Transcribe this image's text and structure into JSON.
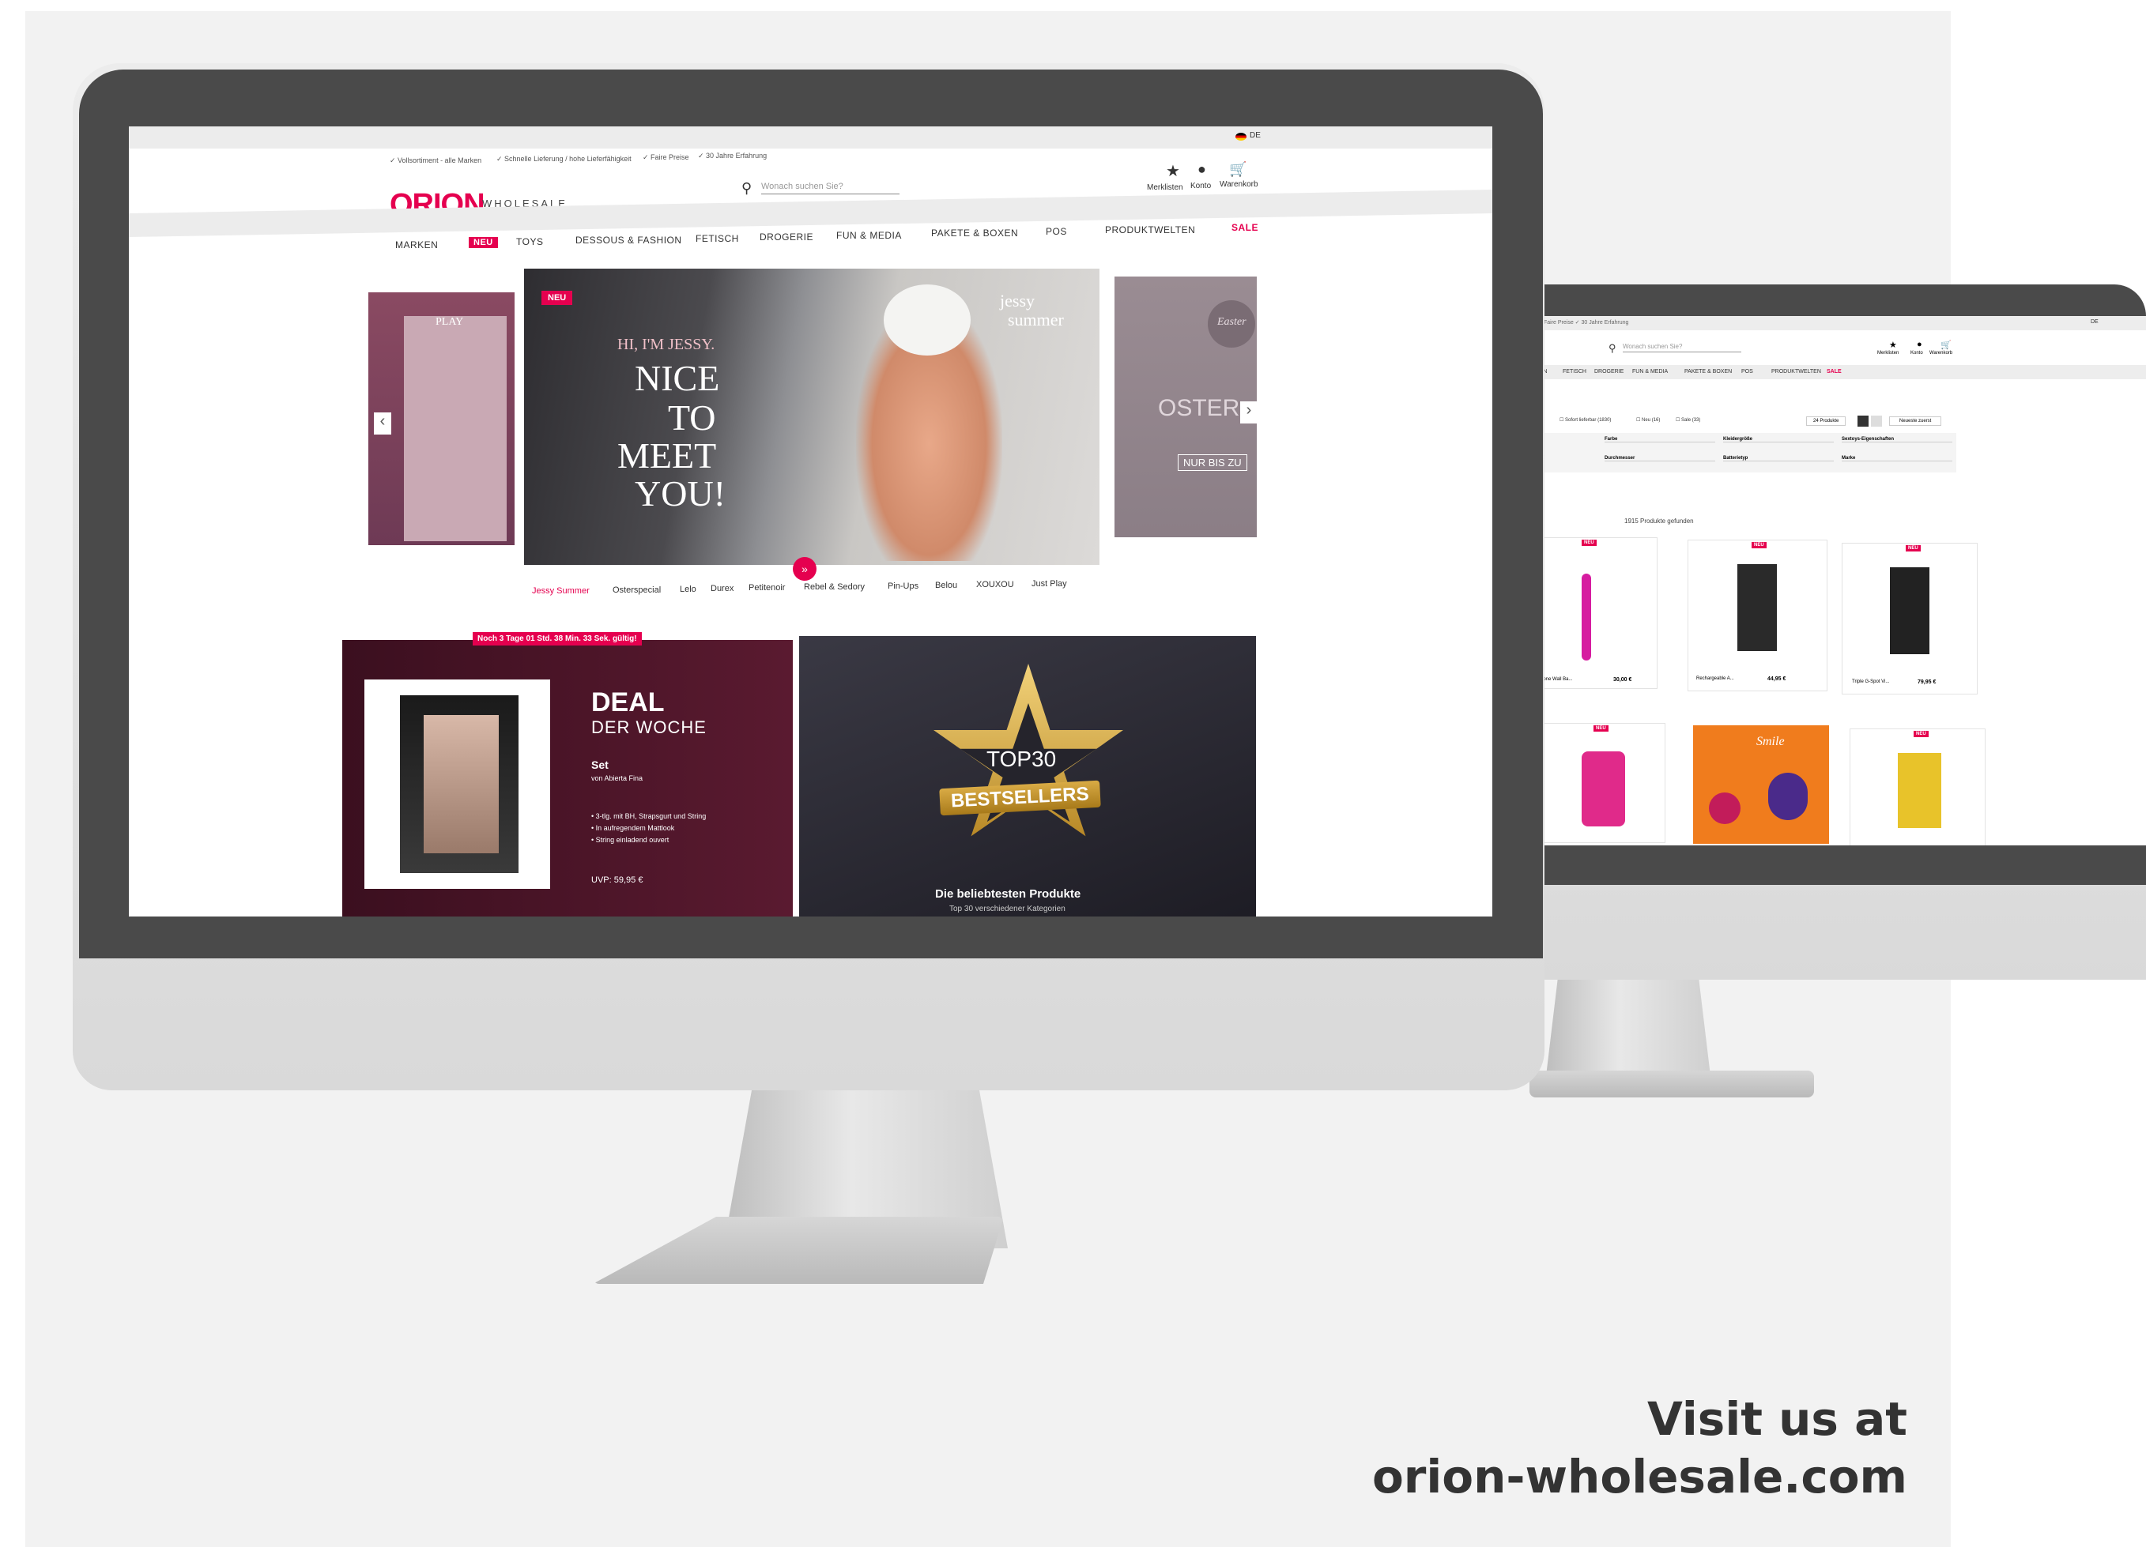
{
  "top_bar": {
    "usps": [
      "✓ Vollsortiment - alle Marken",
      "✓ Schnelle Lieferung / hohe Lieferfähigkeit",
      "✓ Faire Preise",
      "✓ 30 Jahre Erfahrung"
    ],
    "language": "DE"
  },
  "header": {
    "logo_brand": "ORION",
    "logo_sub": "WHOLESALE",
    "search_placeholder": "Wonach suchen Sie?",
    "actions": [
      "Merklisten",
      "Konto",
      "Warenkorb"
    ]
  },
  "nav": {
    "items": [
      "MARKEN",
      "NEU",
      "TOYS",
      "DESSOUS & FASHION",
      "FETISCH",
      "DROGERIE",
      "FUN & MEDIA",
      "PAKETE & BOXEN",
      "POS",
      "PRODUKTWELTEN",
      "SALE"
    ]
  },
  "hero": {
    "badge": "NEU",
    "headline_1": "HI, I'M JESSY.",
    "headline_2": "NICE",
    "headline_3": "TO",
    "headline_4": "MEET",
    "headline_5": "YOU!",
    "brand_1": "jessy",
    "brand_2": "summer",
    "left_slide_brand": "PLAY",
    "right_slide_text": "OSTER",
    "right_slide_tag": "NUR BIS ZU",
    "right_slide_badge": "Easter",
    "brands": [
      "Jessy Summer",
      "Osterspecial",
      "Lelo",
      "Durex",
      "Petitenoir",
      "Rebel & Sedory",
      "Pin-Ups",
      "Belou",
      "XOUXOU",
      "Just Play"
    ]
  },
  "deal": {
    "countdown": "Noch 3 Tage 01 Std. 38 Min. 33 Sek. gültig!",
    "title": "DEAL",
    "subtitle": "DER WOCHE",
    "product": "Set",
    "brand": "von Abierta Fina",
    "features": [
      "• 3-tlg. mit BH, Strapsgurt und String",
      "• In aufregendem Mattlook",
      "• String einladend ouvert"
    ],
    "price": "UVP: 59,95 €"
  },
  "bestseller": {
    "star_line1": "TOP30",
    "star_line2": "BESTSELLERS",
    "caption": "Die beliebtesten Produkte",
    "subcaption": "Top 30 verschiedener Kategorien"
  },
  "listing": {
    "top_bar": "Faire Preise   ✓ 30 Jahre Erfahrung",
    "language": "DE",
    "search_placeholder": "Wonach suchen Sie?",
    "actions": [
      "Merklisten",
      "Konto",
      "Warenkorb"
    ],
    "nav": [
      "ION",
      "FETISCH",
      "DROGERIE",
      "FUN & MEDIA",
      "PAKETE & BOXEN",
      "POS",
      "PRODUKTWELTEN",
      "SALE"
    ],
    "checks": [
      "Sofort lieferbar (1830)",
      "Neu (16)",
      "Sale (33)"
    ],
    "per_page": "24 Produkte",
    "sort": "Neueste zuerst",
    "filters_row1": [
      "Farbe",
      "Kleidergröße",
      "Sextoys-Eigenschaften"
    ],
    "filters_row2": [
      "Durchmesser",
      "Batterietyp",
      "Marke"
    ],
    "results": "1915 Produkte gefunden",
    "products": [
      {
        "badge": "NEU",
        "name": "icone Wall Ba...",
        "price": "30,00 €"
      },
      {
        "badge": "NEU",
        "name": "Rechargeable A...",
        "price": "44,95 €"
      },
      {
        "badge": "NEU",
        "name": "Triple G-Spot Vi...",
        "price": "79,95 €"
      }
    ],
    "row2_badges": [
      "NEU",
      "",
      "NEU"
    ],
    "row2_brand": "Smile"
  },
  "cta": {
    "line1": "Visit us at",
    "line2": "orion-wholesale.com"
  },
  "colors": {
    "accent": "#e5004f",
    "deal_bg": "#4a1226",
    "bestseller_bg": "#2a2933",
    "gold": "#d4a63a"
  }
}
